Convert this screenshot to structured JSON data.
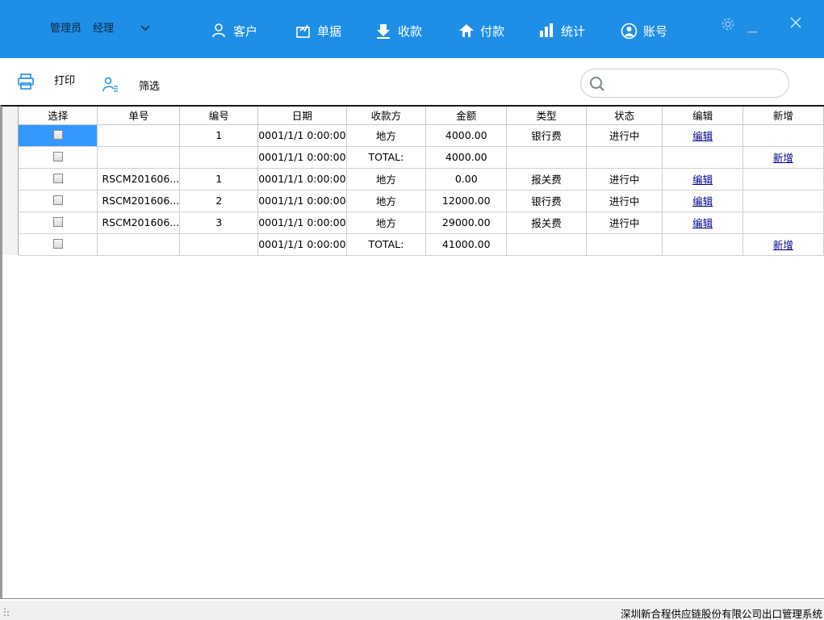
{
  "header": {
    "user_role": "管理员",
    "user_name": "经理",
    "nav": {
      "customers": "客户",
      "documents": "单据",
      "receipts": "收款",
      "payments": "付款",
      "statistics": "统计",
      "account": "账号"
    }
  },
  "toolbar": {
    "print_label": "打印",
    "filter_label": "筛选",
    "search_placeholder": ""
  },
  "table": {
    "columns": [
      "选择",
      "单号",
      "编号",
      "日期",
      "收款方",
      "金额",
      "类型",
      "状态",
      "编辑",
      "新增"
    ],
    "rows": [
      {
        "order_no": "",
        "number": "1",
        "date": "0001/1/1 0:00:00",
        "payee": "地方",
        "amount": "4000.00",
        "type": "银行费",
        "status": "进行中",
        "edit": "编辑",
        "add": ""
      },
      {
        "order_no": "",
        "number": "",
        "date": "0001/1/1 0:00:00",
        "payee": "TOTAL:",
        "amount": "4000.00",
        "type": "",
        "status": "",
        "edit": "",
        "add": "新增"
      },
      {
        "order_no": "RSCM201606...",
        "number": "1",
        "date": "0001/1/1 0:00:00",
        "payee": "地方",
        "amount": "0.00",
        "type": "报关费",
        "status": "进行中",
        "edit": "编辑",
        "add": ""
      },
      {
        "order_no": "RSCM201606...",
        "number": "2",
        "date": "0001/1/1 0:00:00",
        "payee": "地方",
        "amount": "12000.00",
        "type": "银行费",
        "status": "进行中",
        "edit": "编辑",
        "add": ""
      },
      {
        "order_no": "RSCM201606...",
        "number": "3",
        "date": "0001/1/1 0:00:00",
        "payee": "地方",
        "amount": "29000.00",
        "type": "报关费",
        "status": "进行中",
        "edit": "编辑",
        "add": ""
      },
      {
        "order_no": "",
        "number": "",
        "date": "0001/1/1 0:00:00",
        "payee": "TOTAL:",
        "amount": "41000.00",
        "type": "",
        "status": "",
        "edit": "",
        "add": "新增"
      }
    ]
  },
  "status_bar": {
    "text": "深圳新合程供应链股份有限公司出口管理系统"
  },
  "colors": {
    "header_bg": "#1f8ee6",
    "selection": "#3399ff",
    "link": "#00008b",
    "icon_accent": "#1f8ee6"
  }
}
